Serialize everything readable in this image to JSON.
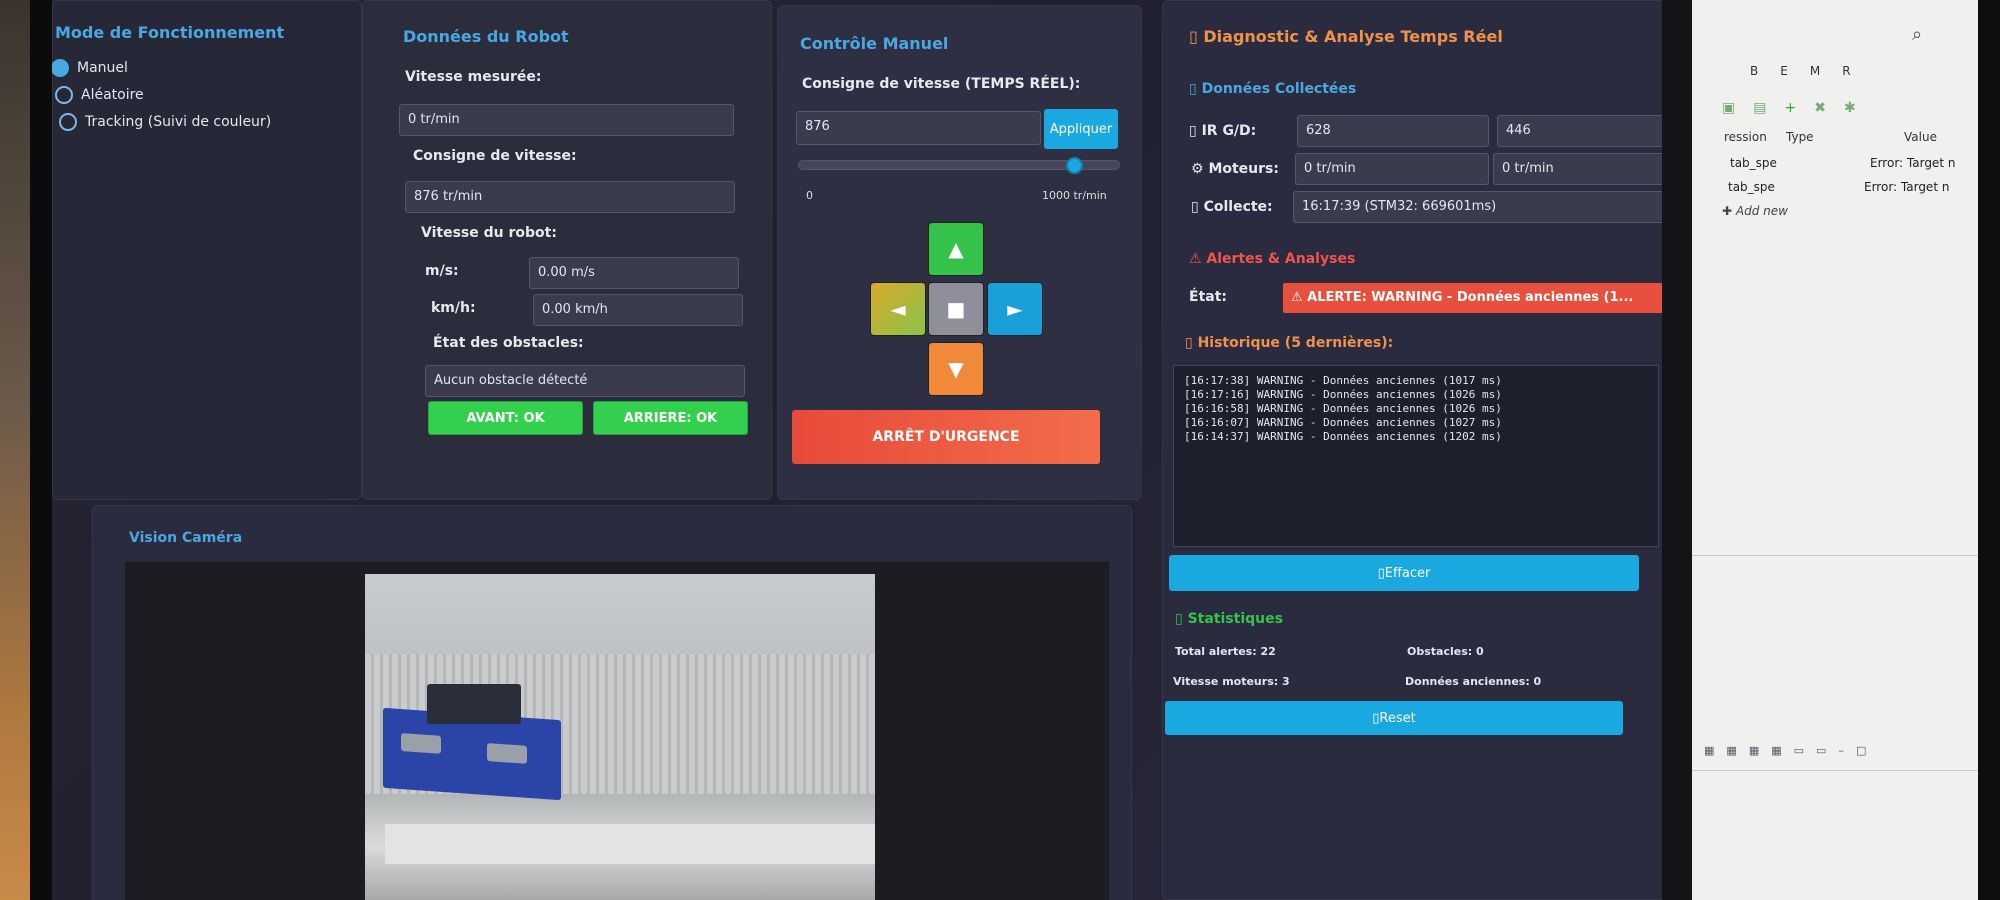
{
  "mode": {
    "title": "Mode de Fonctionnement",
    "options": [
      "Manuel",
      "Aléatoire",
      "Tracking (Suivi de couleur)"
    ],
    "selected": "Manuel"
  },
  "robot": {
    "title": "Données du Robot",
    "measured_speed_label": "Vitesse mesurée:",
    "measured_speed_value": "0 tr/min",
    "setpoint_label": "Consigne de vitesse:",
    "setpoint_value": "876 tr/min",
    "robot_speed_label": "Vitesse du robot:",
    "ms_label": "m/s:",
    "ms_value": "0.00 m/s",
    "kmh_label": "km/h:",
    "kmh_value": "0.00 km/h",
    "obstacles_label": "État des obstacles:",
    "obstacles_value": "Aucun obstacle détecté",
    "front_button": "AVANT: OK",
    "back_button": "ARRIERE: OK"
  },
  "manual": {
    "title": "Contrôle Manuel",
    "setpoint_label": "Consigne de vitesse (TEMPS RÉEL):",
    "setpoint_input": "876",
    "apply_button": "Appliquer",
    "slider_level": 0.876,
    "slider_min": "0",
    "slider_max": "1000 tr/min",
    "up": "▲",
    "left": "◄",
    "stop": "■",
    "right": "►",
    "down": "▼",
    "emergency": "ARRÊT D'URGENCE"
  },
  "diag": {
    "title": "Diagnostic & Analyse Temps Réel",
    "collected_title": "Données Collectées",
    "ir_label": "IR G/D:",
    "ir_left": "628",
    "ir_right": "446",
    "motors_label": "Moteurs:",
    "motor_left": "0 tr/min",
    "motor_right": "0 tr/min",
    "collect_label": "Collecte:",
    "collect_value": "16:17:39 (STM32: 669601ms)",
    "alerts_title": "⚠ Alertes & Analyses",
    "state_label": "État:",
    "state_value": "⚠ ALERTE: WARNING - Données anciennes (1...",
    "history_title": "Historique (5 dernières):",
    "history": [
      "[16:17:38] WARNING - Données anciennes (1017 ms)",
      "[16:17:16] WARNING - Données anciennes (1026 ms)",
      "[16:16:58] WARNING - Données anciennes (1026 ms)",
      "[16:16:07] WARNING - Données anciennes (1027 ms)",
      "[16:14:37] WARNING - Données anciennes (1202 ms)"
    ],
    "clear_button": "Effacer",
    "stats_title": "Statistiques",
    "total_alerts": "Total alertes: 22",
    "obstacles": "Obstacles: 0",
    "motor_speed": "Vitesse moteurs: 3",
    "old_data": "Données anciennes: 0",
    "reset_button": "Reset"
  },
  "camera": {
    "title": "Vision Caméra"
  },
  "ide": {
    "tabs": [
      "B",
      "E",
      "M",
      "R"
    ],
    "columns": [
      "ression",
      "Type",
      "Value"
    ],
    "rows": [
      {
        "expr": "tab_spe",
        "value": "Error: Target n"
      },
      {
        "expr": "tab_spe",
        "value": "Error: Target n"
      }
    ],
    "add_new": "Add new"
  }
}
